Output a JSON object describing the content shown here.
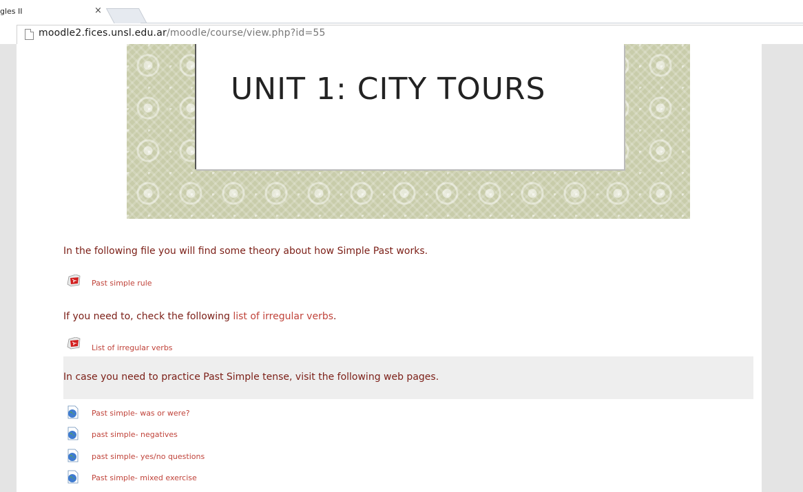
{
  "browser": {
    "tab_title": "gles II",
    "tab_close": "×",
    "url_host": "moodle2.fices.unsl.edu.ar",
    "url_path": "/moodle/course/view.php?id=55"
  },
  "banner": {
    "title": "UNIT 1: CITY TOURS"
  },
  "content": {
    "intro_text": "In the following file you will find some theory about how Simple Past works.",
    "past_simple_rule": "Past simple rule",
    "check_prefix": "If you need to, check the following ",
    "check_link": "list of irregular verbs",
    "check_suffix": ".",
    "irregular_verbs_file": "List of irregular verbs",
    "practice_text": "In case you need to practice Past Simple tense, visit the following web pages.",
    "web_links": [
      {
        "label": "Past simple- was or were?"
      },
      {
        "label": "past simple- negatives"
      },
      {
        "label": "past simple- yes/no questions"
      },
      {
        "label": "Past simple- mixed exercise"
      }
    ]
  },
  "icons": {
    "file": "pdf-icon",
    "url": "globe-icon",
    "page": "page-icon"
  },
  "colors": {
    "text": "#7b1e16",
    "link": "#c0433a",
    "banner": "#c8ccaa"
  }
}
